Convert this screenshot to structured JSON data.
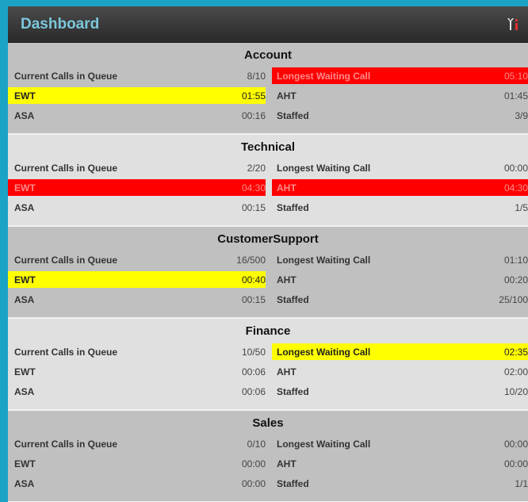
{
  "header": {
    "title": "Dashboard",
    "tools_icon": "tools-icon"
  },
  "colors": {
    "red": "#ff0000",
    "yellow": "#ffff00",
    "title": "#7cc7dc"
  },
  "sections": [
    {
      "title": "Account",
      "rows": [
        [
          {
            "label": "Current Calls in Queue",
            "value": "8/10",
            "status": "normal"
          },
          {
            "label": "Longest Waiting Call",
            "value": "05:10",
            "status": "red"
          }
        ],
        [
          {
            "label": "EWT",
            "value": "01:55",
            "status": "yellow"
          },
          {
            "label": "AHT",
            "value": "01:45",
            "status": "normal"
          }
        ],
        [
          {
            "label": "ASA",
            "value": "00:16",
            "status": "normal"
          },
          {
            "label": "Staffed",
            "value": "3/9",
            "status": "normal"
          }
        ]
      ]
    },
    {
      "title": "Technical",
      "rows": [
        [
          {
            "label": "Current Calls in Queue",
            "value": "2/20",
            "status": "normal"
          },
          {
            "label": "Longest Waiting Call",
            "value": "00:00",
            "status": "normal"
          }
        ],
        [
          {
            "label": "EWT",
            "value": "04:30",
            "status": "red"
          },
          {
            "label": "AHT",
            "value": "04:30",
            "status": "red"
          }
        ],
        [
          {
            "label": "ASA",
            "value": "00:15",
            "status": "normal"
          },
          {
            "label": "Staffed",
            "value": "1/5",
            "status": "normal"
          }
        ]
      ]
    },
    {
      "title": "CustomerSupport",
      "rows": [
        [
          {
            "label": "Current Calls in Queue",
            "value": "16/500",
            "status": "normal"
          },
          {
            "label": "Longest Waiting Call",
            "value": "01:10",
            "status": "normal"
          }
        ],
        [
          {
            "label": "EWT",
            "value": "00:40",
            "status": "yellow"
          },
          {
            "label": "AHT",
            "value": "00:20",
            "status": "normal"
          }
        ],
        [
          {
            "label": "ASA",
            "value": "00:15",
            "status": "normal"
          },
          {
            "label": "Staffed",
            "value": "25/100",
            "status": "normal"
          }
        ]
      ]
    },
    {
      "title": "Finance",
      "rows": [
        [
          {
            "label": "Current Calls in Queue",
            "value": "10/50",
            "status": "normal"
          },
          {
            "label": "Longest Waiting Call",
            "value": "02:35",
            "status": "yellow"
          }
        ],
        [
          {
            "label": "EWT",
            "value": "00:06",
            "status": "normal"
          },
          {
            "label": "AHT",
            "value": "02:00",
            "status": "normal"
          }
        ],
        [
          {
            "label": "ASA",
            "value": "00:06",
            "status": "normal"
          },
          {
            "label": "Staffed",
            "value": "10/20",
            "status": "normal"
          }
        ]
      ]
    },
    {
      "title": "Sales",
      "rows": [
        [
          {
            "label": "Current Calls in Queue",
            "value": "0/10",
            "status": "normal"
          },
          {
            "label": "Longest Waiting Call",
            "value": "00:00",
            "status": "normal"
          }
        ],
        [
          {
            "label": "EWT",
            "value": "00:00",
            "status": "normal"
          },
          {
            "label": "AHT",
            "value": "00:00",
            "status": "normal"
          }
        ],
        [
          {
            "label": "ASA",
            "value": "00:00",
            "status": "normal"
          },
          {
            "label": "Staffed",
            "value": "1/1",
            "status": "normal"
          }
        ]
      ]
    }
  ]
}
